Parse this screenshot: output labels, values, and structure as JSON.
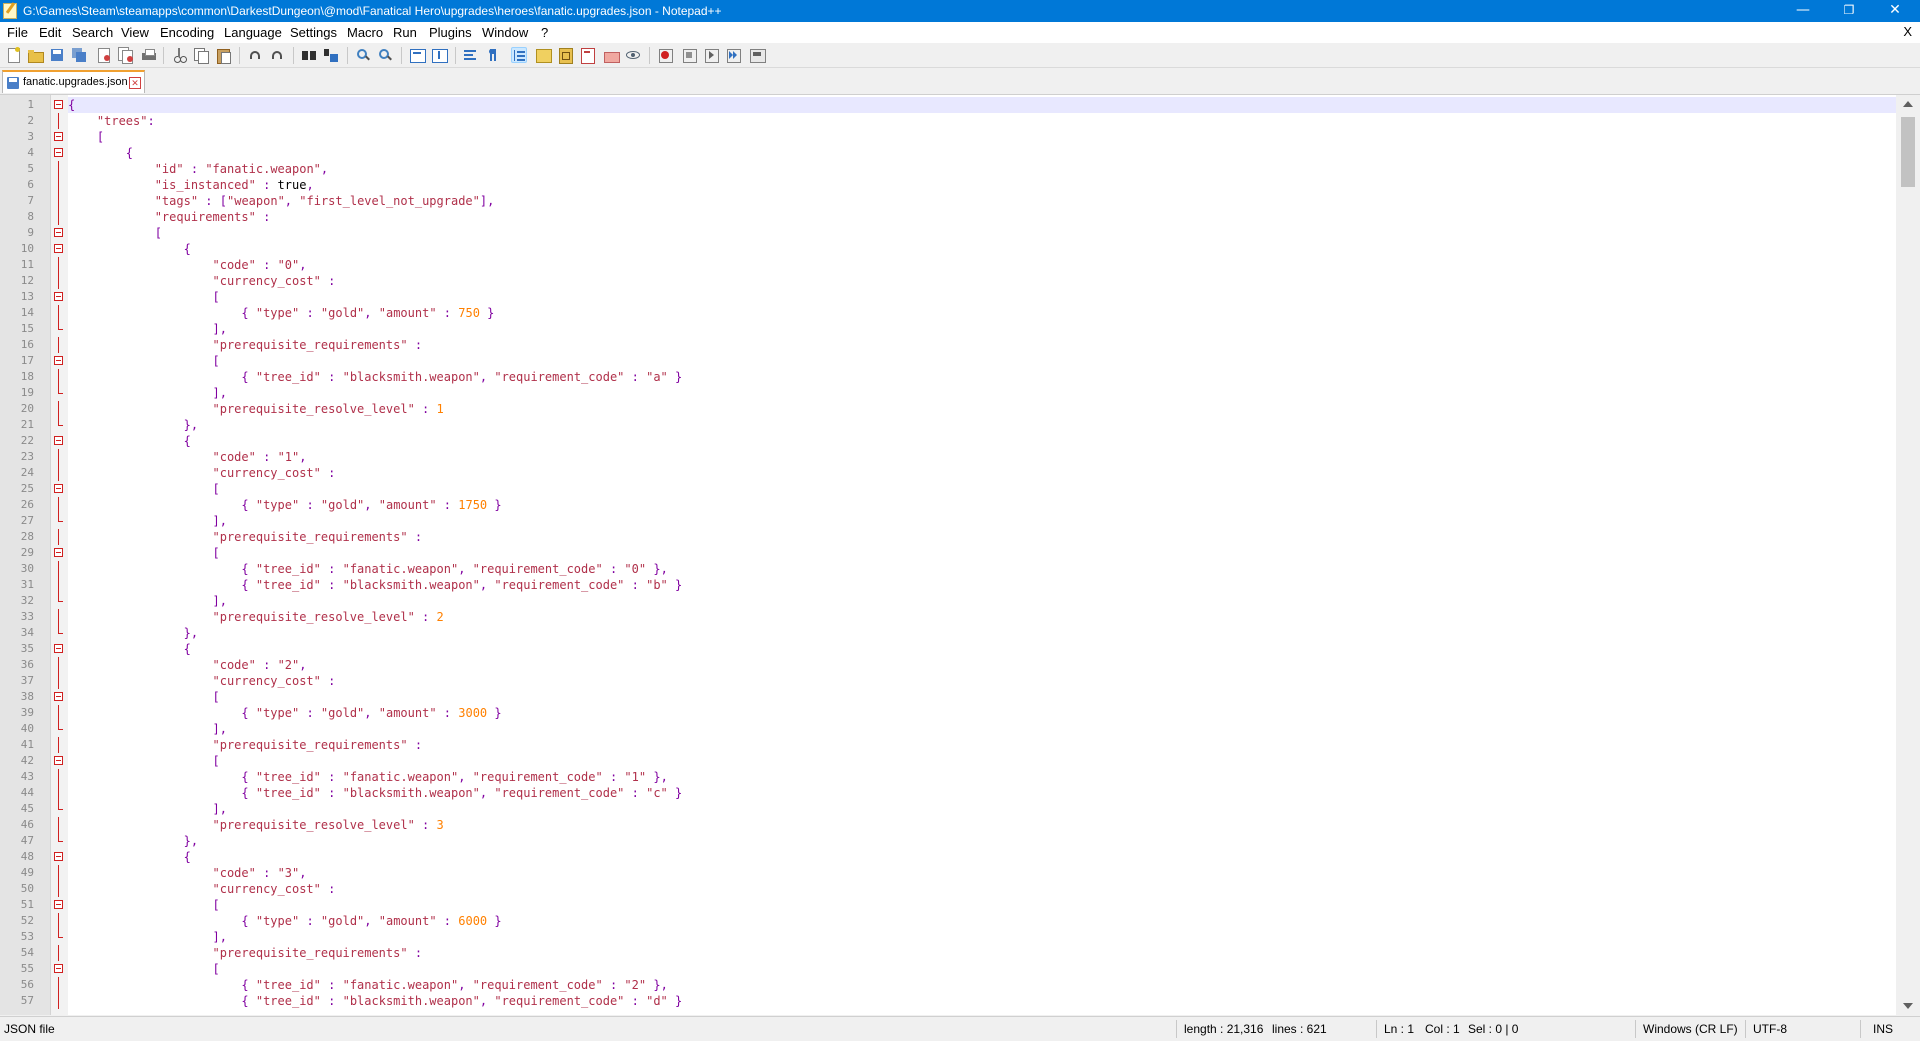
{
  "window": {
    "title": "G:\\Games\\Steam\\steamapps\\common\\DarkestDungeon\\@mod\\Fanatical Hero\\upgrades\\heroes\\fanatic.upgrades.json - Notepad++",
    "minimize": "—",
    "restore": "❐",
    "close": "✕"
  },
  "menu": {
    "items": [
      "File",
      "Edit",
      "Search",
      "View",
      "Encoding",
      "Language",
      "Settings",
      "Macro",
      "Run",
      "Plugins",
      "Window",
      "?"
    ],
    "close_label": "X"
  },
  "toolbar": {
    "buttons": [
      "new-file-icon",
      "open-file-icon",
      "save-icon",
      "save-all-icon",
      "close-icon",
      "close-all-icon",
      "print-icon",
      "cut-icon",
      "copy-icon",
      "paste-icon",
      "undo-icon",
      "redo-icon",
      "find-icon",
      "replace-icon",
      "zoom-in-icon",
      "zoom-out-icon",
      "sync-vertical-icon",
      "sync-horizontal-icon",
      "word-wrap-icon",
      "show-all-chars-icon",
      "indent-guide-icon",
      "udl-icon",
      "doc-map-icon",
      "function-list-icon",
      "folder-workspace-icon",
      "monitoring-icon",
      "record-macro-icon",
      "stop-macro-icon",
      "play-macro-icon",
      "run-macro-multiple-icon",
      "save-macro-icon"
    ]
  },
  "tabs": [
    {
      "label": "fanatic.upgrades.json",
      "active": true
    }
  ],
  "editor": {
    "lines": [
      {
        "n": "1",
        "code": "{",
        "fold": "start",
        "current": true
      },
      {
        "n": "2",
        "code": "    \"trees\":",
        "fold": "line"
      },
      {
        "n": "3",
        "code": "    [",
        "fold": "start"
      },
      {
        "n": "4",
        "code": "        {",
        "fold": "start"
      },
      {
        "n": "5",
        "code": "            \"id\" : \"fanatic.weapon\",",
        "fold": "line"
      },
      {
        "n": "6",
        "code": "            \"is_instanced\" : true,",
        "fold": "line"
      },
      {
        "n": "7",
        "code": "            \"tags\" : [\"weapon\", \"first_level_not_upgrade\"],",
        "fold": "line"
      },
      {
        "n": "8",
        "code": "            \"requirements\" :",
        "fold": "line"
      },
      {
        "n": "9",
        "code": "            [",
        "fold": "start"
      },
      {
        "n": "10",
        "code": "                {",
        "fold": "start"
      },
      {
        "n": "11",
        "code": "                    \"code\" : \"0\",",
        "fold": "line"
      },
      {
        "n": "12",
        "code": "                    \"currency_cost\" :",
        "fold": "line"
      },
      {
        "n": "13",
        "code": "                    [",
        "fold": "start"
      },
      {
        "n": "14",
        "code": "                        { \"type\" : \"gold\", \"amount\" : 750 }",
        "fold": "line"
      },
      {
        "n": "15",
        "code": "                    ],",
        "fold": "end"
      },
      {
        "n": "16",
        "code": "                    \"prerequisite_requirements\" :",
        "fold": "line"
      },
      {
        "n": "17",
        "code": "                    [",
        "fold": "start"
      },
      {
        "n": "18",
        "code": "                        { \"tree_id\" : \"blacksmith.weapon\", \"requirement_code\" : \"a\" }",
        "fold": "line"
      },
      {
        "n": "19",
        "code": "                    ],",
        "fold": "end"
      },
      {
        "n": "20",
        "code": "                    \"prerequisite_resolve_level\" : 1",
        "fold": "line"
      },
      {
        "n": "21",
        "code": "                },",
        "fold": "end"
      },
      {
        "n": "22",
        "code": "                {",
        "fold": "start"
      },
      {
        "n": "23",
        "code": "                    \"code\" : \"1\",",
        "fold": "line"
      },
      {
        "n": "24",
        "code": "                    \"currency_cost\" :",
        "fold": "line"
      },
      {
        "n": "25",
        "code": "                    [",
        "fold": "start"
      },
      {
        "n": "26",
        "code": "                        { \"type\" : \"gold\", \"amount\" : 1750 }",
        "fold": "line"
      },
      {
        "n": "27",
        "code": "                    ],",
        "fold": "end"
      },
      {
        "n": "28",
        "code": "                    \"prerequisite_requirements\" :",
        "fold": "line"
      },
      {
        "n": "29",
        "code": "                    [",
        "fold": "start"
      },
      {
        "n": "30",
        "code": "                        { \"tree_id\" : \"fanatic.weapon\", \"requirement_code\" : \"0\" },",
        "fold": "line"
      },
      {
        "n": "31",
        "code": "                        { \"tree_id\" : \"blacksmith.weapon\", \"requirement_code\" : \"b\" }",
        "fold": "line"
      },
      {
        "n": "32",
        "code": "                    ],",
        "fold": "end"
      },
      {
        "n": "33",
        "code": "                    \"prerequisite_resolve_level\" : 2",
        "fold": "line"
      },
      {
        "n": "34",
        "code": "                },",
        "fold": "end"
      },
      {
        "n": "35",
        "code": "                {",
        "fold": "start"
      },
      {
        "n": "36",
        "code": "                    \"code\" : \"2\",",
        "fold": "line"
      },
      {
        "n": "37",
        "code": "                    \"currency_cost\" :",
        "fold": "line"
      },
      {
        "n": "38",
        "code": "                    [",
        "fold": "start"
      },
      {
        "n": "39",
        "code": "                        { \"type\" : \"gold\", \"amount\" : 3000 }",
        "fold": "line"
      },
      {
        "n": "40",
        "code": "                    ],",
        "fold": "end"
      },
      {
        "n": "41",
        "code": "                    \"prerequisite_requirements\" :",
        "fold": "line"
      },
      {
        "n": "42",
        "code": "                    [",
        "fold": "start"
      },
      {
        "n": "43",
        "code": "                        { \"tree_id\" : \"fanatic.weapon\", \"requirement_code\" : \"1\" },",
        "fold": "line"
      },
      {
        "n": "44",
        "code": "                        { \"tree_id\" : \"blacksmith.weapon\", \"requirement_code\" : \"c\" }",
        "fold": "line"
      },
      {
        "n": "45",
        "code": "                    ],",
        "fold": "end"
      },
      {
        "n": "46",
        "code": "                    \"prerequisite_resolve_level\" : 3",
        "fold": "line"
      },
      {
        "n": "47",
        "code": "                },",
        "fold": "end"
      },
      {
        "n": "48",
        "code": "                {",
        "fold": "start"
      },
      {
        "n": "49",
        "code": "                    \"code\" : \"3\",",
        "fold": "line"
      },
      {
        "n": "50",
        "code": "                    \"currency_cost\" :",
        "fold": "line"
      },
      {
        "n": "51",
        "code": "                    [",
        "fold": "start"
      },
      {
        "n": "52",
        "code": "                        { \"type\" : \"gold\", \"amount\" : 6000 }",
        "fold": "line"
      },
      {
        "n": "53",
        "code": "                    ],",
        "fold": "end"
      },
      {
        "n": "54",
        "code": "                    \"prerequisite_requirements\" :",
        "fold": "line"
      },
      {
        "n": "55",
        "code": "                    [",
        "fold": "start"
      },
      {
        "n": "56",
        "code": "                        { \"tree_id\" : \"fanatic.weapon\", \"requirement_code\" : \"2\" },",
        "fold": "line"
      },
      {
        "n": "57",
        "code": "                        { \"tree_id\" : \"blacksmith.weapon\", \"requirement_code\" : \"d\" }",
        "fold": "line"
      }
    ]
  },
  "status": {
    "file_type": "JSON file",
    "length": "length : 21,316",
    "lines": "lines : 621",
    "ln": "Ln : 1",
    "col": "Col : 1",
    "sel": "Sel : 0 | 0",
    "eol": "Windows (CR LF)",
    "encoding": "UTF-8",
    "mode": "INS"
  },
  "colors": {
    "titlebar": "#0078d7",
    "code_text": "#b0304a",
    "number": "#ff8000",
    "operator": "#8000a0",
    "fold_marker": "#d02020",
    "current_line": "#e8e8ff"
  }
}
